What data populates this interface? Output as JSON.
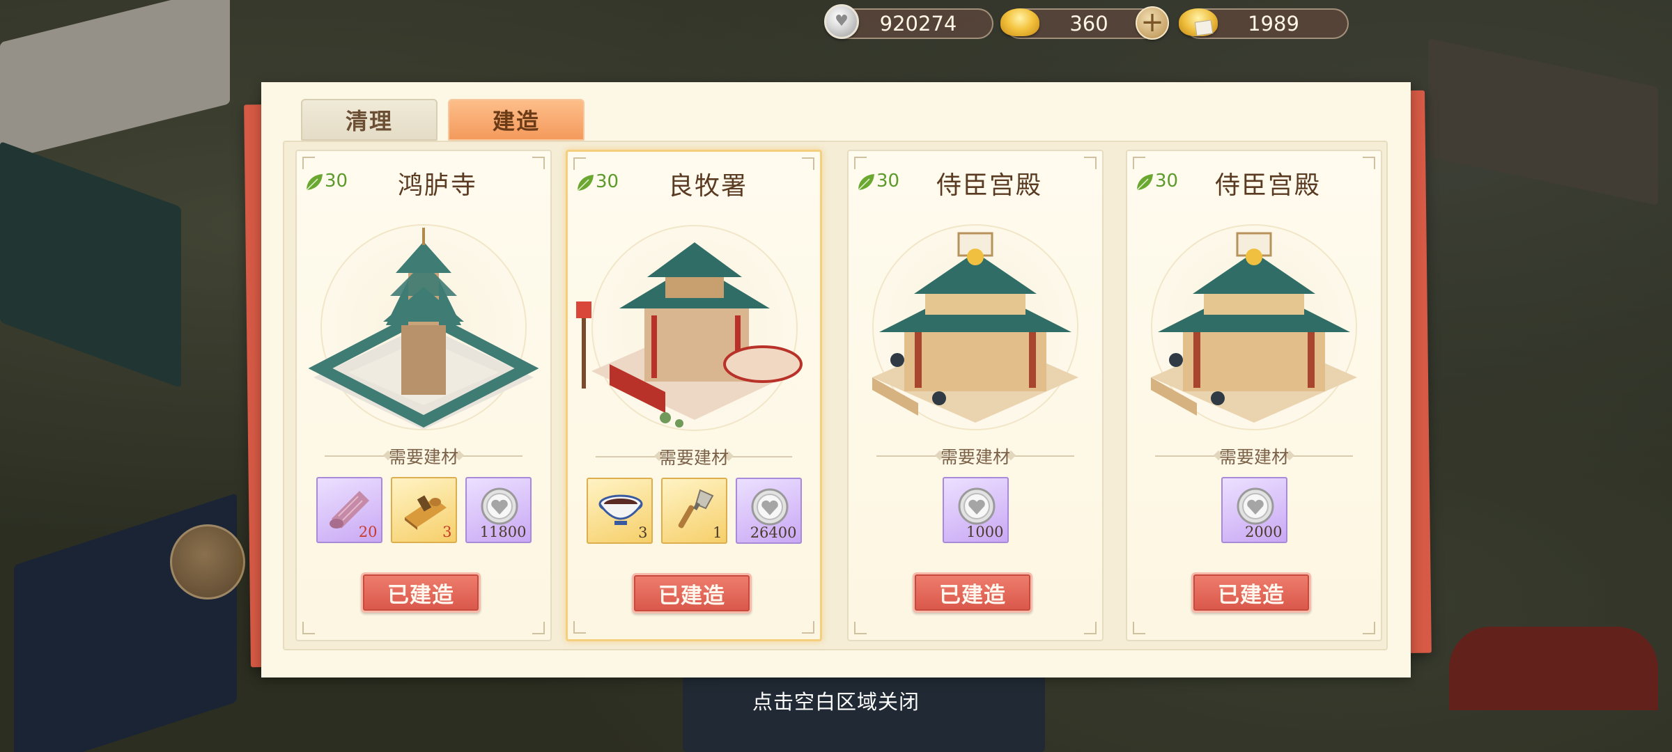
{
  "currency": {
    "silver": "920274",
    "gold": "360",
    "ticket": "1989"
  },
  "tabs": [
    {
      "label": "清理",
      "active": false
    },
    {
      "label": "建造",
      "active": true
    }
  ],
  "cards": [
    {
      "prosperity": "30",
      "title": "鸿胪寺",
      "need_label": "需要建材",
      "materials": [
        {
          "icon": "cloth-roll-icon",
          "qty": "20"
        },
        {
          "icon": "wood-plane-icon",
          "qty": "3"
        },
        {
          "icon": "silver-coin-icon",
          "qty": "11800"
        }
      ],
      "button": "已建造"
    },
    {
      "prosperity": "30",
      "title": "良牧署",
      "need_label": "需要建材",
      "materials": [
        {
          "icon": "lacquer-bowl-icon",
          "qty": "3"
        },
        {
          "icon": "trowel-icon",
          "qty": "1"
        },
        {
          "icon": "silver-coin-icon",
          "qty": "26400"
        }
      ],
      "button": "已建造"
    },
    {
      "prosperity": "30",
      "title": "侍臣宫殿",
      "need_label": "需要建材",
      "materials": [
        {
          "icon": "silver-coin-icon",
          "qty": "1000"
        }
      ],
      "button": "已建造"
    },
    {
      "prosperity": "30",
      "title": "侍臣宫殿",
      "need_label": "需要建材",
      "materials": [
        {
          "icon": "silver-coin-icon",
          "qty": "2000"
        }
      ],
      "button": "已建造"
    }
  ],
  "close_hint": "点击空白区域关闭",
  "colors": {
    "accent_button": "#d9574a",
    "active_tab": "#f49a5c",
    "prosperity_green": "#5d9a2c"
  }
}
